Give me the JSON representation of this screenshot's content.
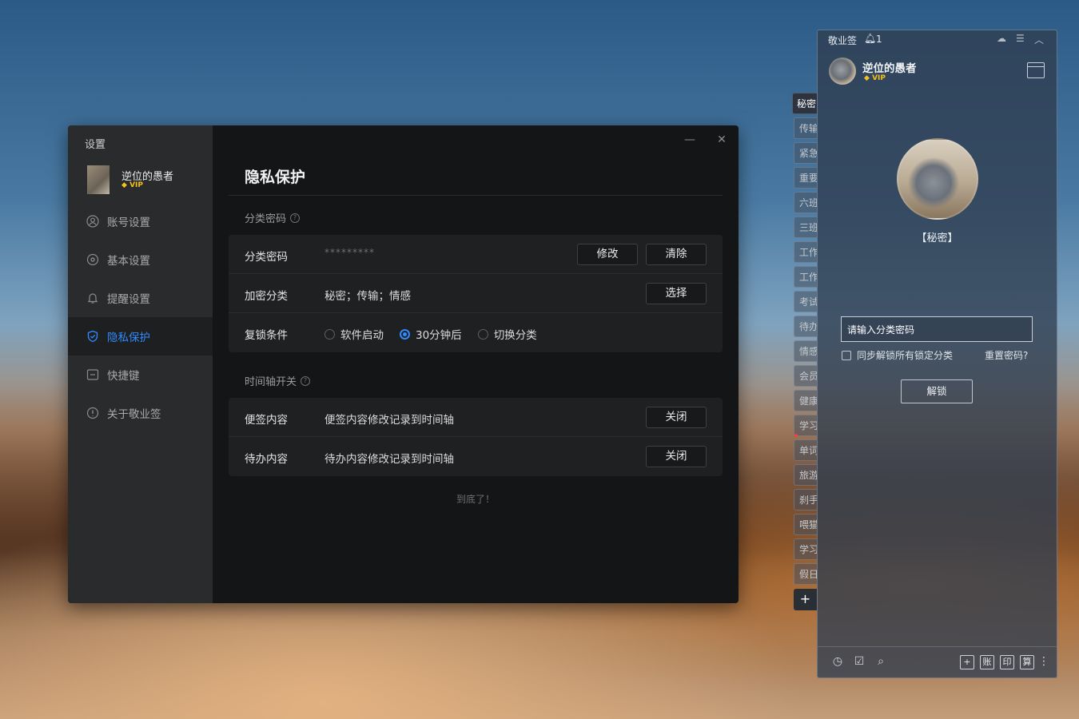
{
  "settings": {
    "window_title": "设置",
    "user": {
      "name": "逆位的愚者",
      "vip": "VIP"
    },
    "menu": [
      {
        "id": "account",
        "label": "账号设置",
        "icon": "user-icon",
        "active": false
      },
      {
        "id": "basic",
        "label": "基本设置",
        "icon": "gear-icon",
        "active": false
      },
      {
        "id": "reminder",
        "label": "提醒设置",
        "icon": "bell-icon",
        "active": false
      },
      {
        "id": "privacy",
        "label": "隐私保护",
        "icon": "shield-icon",
        "active": true
      },
      {
        "id": "shortcut",
        "label": "快捷键",
        "icon": "keyboard-icon",
        "active": false
      },
      {
        "id": "about",
        "label": "关于敬业签",
        "icon": "info-icon",
        "active": false
      }
    ],
    "controls": {
      "minimize": "—",
      "close": "✕"
    },
    "page_title": "隐私保护",
    "category_password_section": {
      "label": "分类密码",
      "help": "?",
      "rows": {
        "password": {
          "label": "分类密码",
          "value": "*********",
          "modify_btn": "修改",
          "clear_btn": "清除"
        },
        "encrypted": {
          "label": "加密分类",
          "value": "秘密；传输；情感",
          "select_btn": "选择"
        },
        "relock": {
          "label": "复锁条件",
          "options": [
            {
              "label": "软件启动",
              "checked": false
            },
            {
              "label": "30分钟后",
              "checked": true
            },
            {
              "label": "切换分类",
              "checked": false
            }
          ]
        }
      }
    },
    "timeline_section": {
      "label": "时间轴开关",
      "help": "?",
      "rows": {
        "note": {
          "label": "便签内容",
          "value": "便签内容修改记录到时间轴",
          "btn": "关闭"
        },
        "todo": {
          "label": "待办内容",
          "value": "待办内容修改记录到时间轴",
          "btn": "关闭"
        }
      }
    },
    "end_text": "到底了！"
  },
  "categories": [
    {
      "label": "秘密",
      "active": true
    },
    {
      "label": "传输",
      "active": false
    },
    {
      "label": "紧急",
      "active": false
    },
    {
      "label": "重要",
      "active": false
    },
    {
      "label": "六班",
      "active": false
    },
    {
      "label": "三班",
      "active": false
    },
    {
      "label": "工作",
      "active": false
    },
    {
      "label": "工作",
      "active": false
    },
    {
      "label": "考试",
      "active": false
    },
    {
      "label": "待办",
      "active": false
    },
    {
      "label": "情感",
      "active": false
    },
    {
      "label": "会员",
      "active": false
    },
    {
      "label": "健康",
      "active": false
    },
    {
      "label": "学习",
      "active": false
    },
    {
      "label": "单词",
      "active": false
    },
    {
      "label": "旅游",
      "active": false
    },
    {
      "label": "刹手",
      "active": false
    },
    {
      "label": "喂猫",
      "active": false
    },
    {
      "label": "学习",
      "active": false
    },
    {
      "label": "假日",
      "active": false
    }
  ],
  "category_add": "+",
  "note_panel": {
    "app_name": "敬业签",
    "notification_count": "1",
    "user": {
      "name": "逆位的愚者",
      "vip": "VIP"
    },
    "locked_category": "【秘密】",
    "password_input": {
      "value": "请输入分类密码"
    },
    "sync_unlock_label": "同步解锁所有锁定分类",
    "reset_password": "重置密码?",
    "unlock_btn": "解锁",
    "footer_buttons": {
      "add": "+",
      "account": "账",
      "print": "印",
      "calc": "算"
    }
  }
}
